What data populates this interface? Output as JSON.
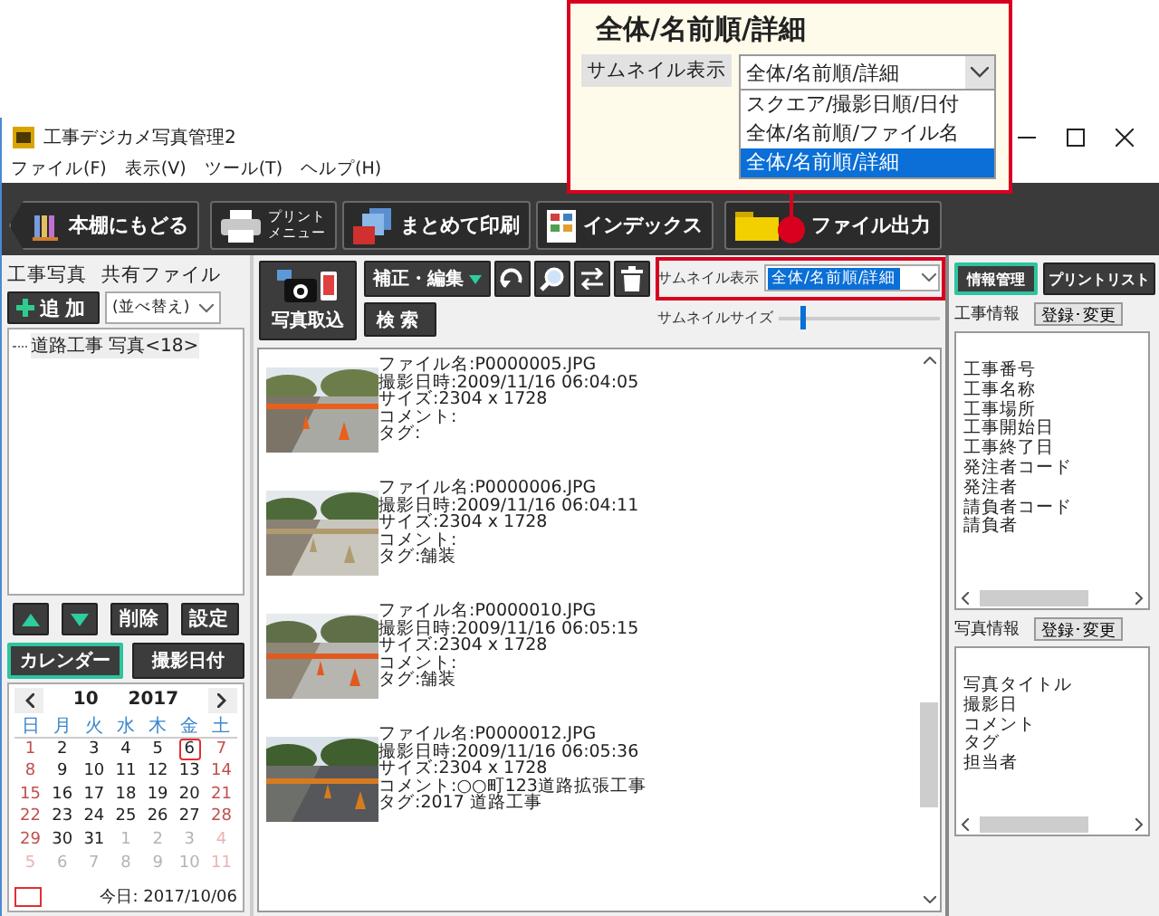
{
  "callout": {
    "title": "全体/名前順/詳細",
    "label": "サムネイル表示",
    "value": "全体/名前順/詳細",
    "options": [
      {
        "label": "スクエア/撮影日順/日付",
        "selected": false
      },
      {
        "label": "全体/名前順/ファイル名",
        "selected": false
      },
      {
        "label": "全体/名前順/詳細",
        "selected": true
      }
    ]
  },
  "window": {
    "title": "工事デジカメ写真管理2"
  },
  "menu": [
    "ファイル(F)",
    "表示(V)",
    "ツール(T)",
    "ヘルプ(H)"
  ],
  "toolbar": [
    {
      "label": "本棚にもどる",
      "kind": "back"
    },
    {
      "lines": [
        "プリント",
        "メニュー"
      ],
      "kind": "print"
    },
    {
      "label": "まとめて印刷",
      "kind": "batch"
    },
    {
      "label": "インデックス",
      "kind": "index"
    },
    {
      "label": "ファイル出力",
      "kind": "export"
    }
  ],
  "left_panel": {
    "tabs": [
      "工事写真",
      "共有ファイル"
    ],
    "add_button": "追加",
    "sort": {
      "placeholder": "(並べ替え)"
    },
    "tree": [
      {
        "label": "道路工事 写真<18>"
      }
    ],
    "buttons": [
      "削除",
      "設定"
    ],
    "view_tabs": [
      {
        "label": "カレンダー",
        "selected": true
      },
      {
        "label": "撮影日付",
        "selected": false
      }
    ],
    "calendar": {
      "month": "10",
      "year": "2017",
      "weekdays": [
        "日",
        "月",
        "火",
        "水",
        "木",
        "金",
        "土"
      ],
      "weeks": [
        [
          {
            "day": "1",
            "muted": false,
            "today": false
          },
          {
            "day": "2",
            "muted": false,
            "today": false
          },
          {
            "day": "3",
            "muted": false,
            "today": false
          },
          {
            "day": "4",
            "muted": false,
            "today": false
          },
          {
            "day": "5",
            "muted": false,
            "today": false
          },
          {
            "day": "6",
            "muted": false,
            "today": true
          },
          {
            "day": "7",
            "muted": false,
            "today": false
          }
        ],
        [
          {
            "day": "8",
            "muted": false,
            "today": false
          },
          {
            "day": "9",
            "muted": false,
            "today": false
          },
          {
            "day": "10",
            "muted": false,
            "today": false
          },
          {
            "day": "11",
            "muted": false,
            "today": false
          },
          {
            "day": "12",
            "muted": false,
            "today": false
          },
          {
            "day": "13",
            "muted": false,
            "today": false
          },
          {
            "day": "14",
            "muted": false,
            "today": false
          }
        ],
        [
          {
            "day": "15",
            "muted": false,
            "today": false
          },
          {
            "day": "16",
            "muted": false,
            "today": false
          },
          {
            "day": "17",
            "muted": false,
            "today": false
          },
          {
            "day": "18",
            "muted": false,
            "today": false
          },
          {
            "day": "19",
            "muted": false,
            "today": false
          },
          {
            "day": "20",
            "muted": false,
            "today": false
          },
          {
            "day": "21",
            "muted": false,
            "today": false
          }
        ],
        [
          {
            "day": "22",
            "muted": false,
            "today": false
          },
          {
            "day": "23",
            "muted": false,
            "today": false
          },
          {
            "day": "24",
            "muted": false,
            "today": false
          },
          {
            "day": "25",
            "muted": false,
            "today": false
          },
          {
            "day": "26",
            "muted": false,
            "today": false
          },
          {
            "day": "27",
            "muted": false,
            "today": false
          },
          {
            "day": "28",
            "muted": false,
            "today": false
          }
        ],
        [
          {
            "day": "29",
            "muted": false,
            "today": false
          },
          {
            "day": "30",
            "muted": false,
            "today": false
          },
          {
            "day": "31",
            "muted": false,
            "today": false
          },
          {
            "day": "1",
            "muted": true,
            "today": false
          },
          {
            "day": "2",
            "muted": true,
            "today": false
          },
          {
            "day": "3",
            "muted": true,
            "today": false
          },
          {
            "day": "4",
            "muted": true,
            "today": false
          }
        ],
        [
          {
            "day": "5",
            "muted": true,
            "today": false
          },
          {
            "day": "6",
            "muted": true,
            "today": false
          },
          {
            "day": "7",
            "muted": true,
            "today": false
          },
          {
            "day": "8",
            "muted": true,
            "today": false
          },
          {
            "day": "9",
            "muted": true,
            "today": false
          },
          {
            "day": "10",
            "muted": true,
            "today": false
          },
          {
            "day": "11",
            "muted": true,
            "today": false
          }
        ]
      ],
      "today_label": "今日: 2017/10/06"
    }
  },
  "middle_panel": {
    "import_button": "写真取込",
    "edit_button": "補正・編集",
    "search_button": "検索",
    "thumbnail_display": {
      "label": "サムネイル表示",
      "value": "全体/名前順/詳細"
    },
    "thumbnail_size": {
      "label": "サムネイルサイズ",
      "level": 0.13
    },
    "photos": [
      {
        "lines": [
          "ファイル名:P0000005.JPG",
          "撮影日時:2009/11/16 06:04:05",
          "サイズ:2304 x 1728",
          "コメント:",
          "タグ:"
        ]
      },
      {
        "lines": [
          "ファイル名:P0000006.JPG",
          "撮影日時:2009/11/16 06:04:11",
          "サイズ:2304 x 1728",
          "コメント:",
          "タグ:舗装"
        ]
      },
      {
        "lines": [
          "ファイル名:P0000010.JPG",
          "撮影日時:2009/11/16 06:05:15",
          "サイズ:2304 x 1728",
          "コメント:",
          "タグ:舗装"
        ]
      },
      {
        "lines": [
          "ファイル名:P0000012.JPG",
          "撮影日時:2009/11/16 06:05:36",
          "サイズ:2304 x 1728",
          "コメント:○○町123道路拡張工事",
          "タグ:2017 道路工事"
        ]
      }
    ]
  },
  "right_panel": {
    "tabs": [
      {
        "label": "情報管理",
        "selected": true
      },
      {
        "label": "プリントリスト",
        "selected": false
      }
    ],
    "sections": [
      {
        "title": "工事情報",
        "button": "登録･変更",
        "items": [
          "工事番号",
          "工事名称",
          "工事場所",
          "工事開始日",
          "工事終了日",
          "発注者コード",
          "発注者",
          "請負者コード",
          "請負者"
        ]
      },
      {
        "title": "写真情報",
        "button": "登録･変更",
        "items": [
          "写真タイトル",
          "撮影日",
          "コメント",
          "タグ",
          "担当者"
        ]
      }
    ]
  }
}
